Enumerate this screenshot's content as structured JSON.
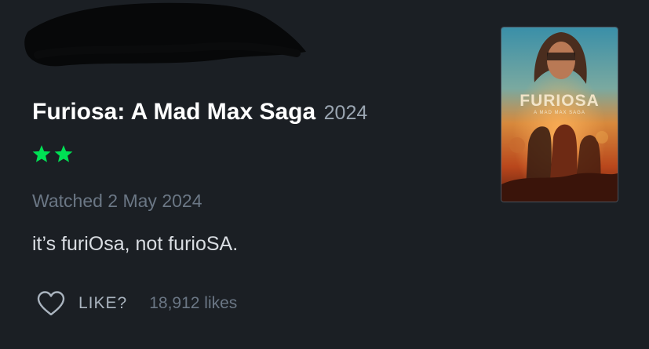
{
  "film": {
    "title": "Furiosa: A Mad Max Saga",
    "year": "2024",
    "rating_stars": 2,
    "rating_max": 5
  },
  "entry": {
    "watched": "Watched 2 May 2024",
    "review": "it’s furiOsa, not furioSA."
  },
  "likes": {
    "label": "LIKE?",
    "count": "18,912 likes"
  },
  "poster": {
    "title_text": "FURIOSA",
    "subtitle_text": "A MAD MAX SAGA"
  },
  "colors": {
    "background": "#1b1f24",
    "star": "#00e054",
    "title": "#ffffff",
    "muted": "#6b7785"
  },
  "icons": {
    "star": "star-icon",
    "heart": "heart-outline-icon"
  }
}
